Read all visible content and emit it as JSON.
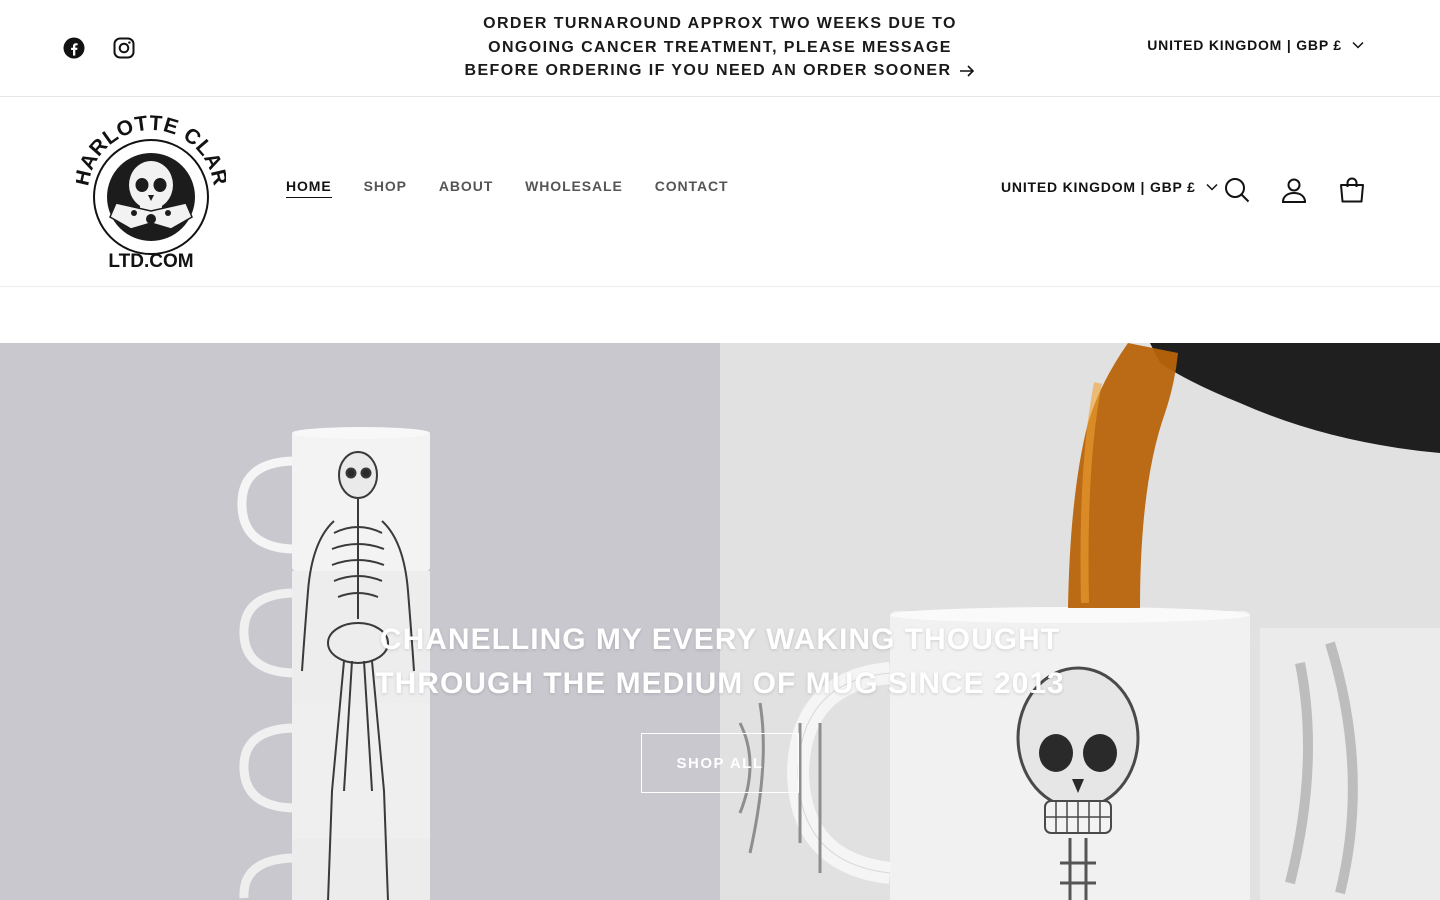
{
  "announcement": {
    "text": "Order turnaround approx two weeks due to ongoing cancer treatment, please message before ordering if you need an order sooner"
  },
  "social": [
    {
      "icon": "facebook-icon"
    },
    {
      "icon": "instagram-icon"
    }
  ],
  "country_selector_top": {
    "label": "UNITED KINGDOM | GBP £"
  },
  "logo": {
    "top_text": "CHARLOTTE CLARK",
    "bottom_text": "LTD.COM"
  },
  "nav": {
    "items": [
      {
        "label": "HOME",
        "active": true
      },
      {
        "label": "SHOP",
        "active": false
      },
      {
        "label": "ABOUT",
        "active": false
      },
      {
        "label": "WHOLESALE",
        "active": false
      },
      {
        "label": "CONTACT",
        "active": false
      }
    ]
  },
  "header": {
    "country_label": "UNITED KINGDOM | GBP £",
    "icons": [
      "search-icon",
      "account-icon",
      "cart-icon"
    ]
  },
  "hero": {
    "title": "CHANELLING MY EVERY WAKING THOUGHT THROUGH THE MEDIUM OF MUG SINCE 2013",
    "button_label": "SHOP ALL"
  },
  "colors": {
    "text": "#121212",
    "muted": "#555555",
    "hero_left": "#c9c8cf",
    "hero_right": "#e1e1e1",
    "coffee": "#b8640b"
  }
}
